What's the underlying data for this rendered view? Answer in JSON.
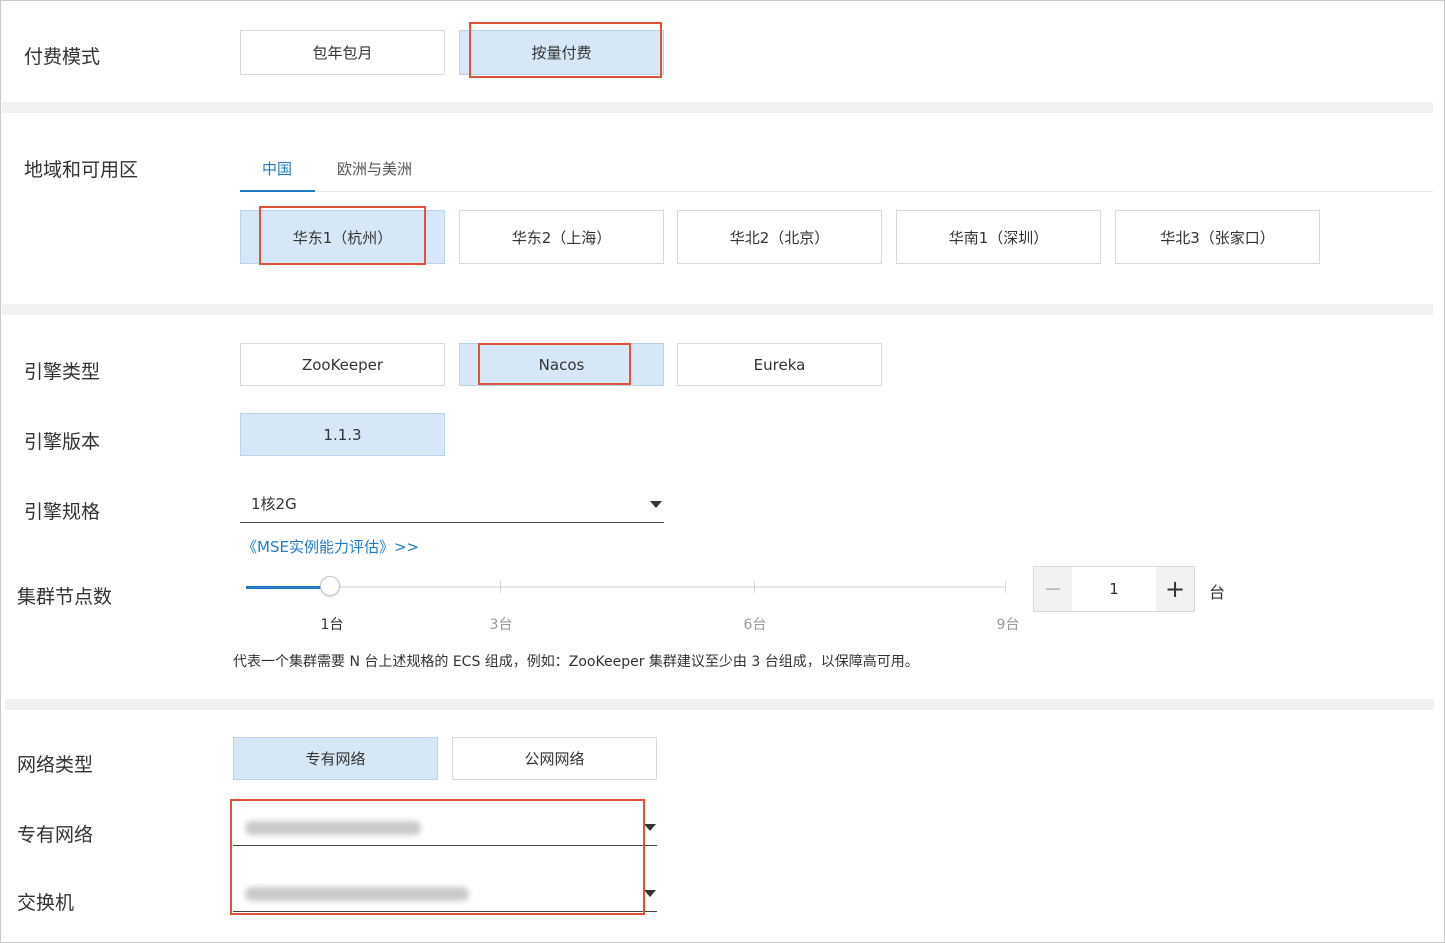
{
  "billing": {
    "label": "付费模式",
    "options": [
      "包年包月",
      "按量付费"
    ],
    "selected": "按量付费"
  },
  "region": {
    "label": "地域和可用区",
    "tabs": [
      "中国",
      "欧洲与美洲"
    ],
    "active_tab": "中国",
    "options": [
      "华东1（杭州）",
      "华东2（上海）",
      "华北2（北京）",
      "华南1（深圳）",
      "华北3（张家口）"
    ],
    "selected": "华东1（杭州）"
  },
  "engine": {
    "type_label": "引擎类型",
    "types": [
      "ZooKeeper",
      "Nacos",
      "Eureka"
    ],
    "selected_type": "Nacos",
    "version_label": "引擎版本",
    "version": "1.1.3",
    "spec_label": "引擎规格",
    "spec_value": "1核2G",
    "eval_link": "《MSE实例能力评估》>>"
  },
  "nodes": {
    "label": "集群节点数",
    "ticks": [
      "1台",
      "3台",
      "6台",
      "9台"
    ],
    "slider_min": 1,
    "slider_max": 9,
    "slider_value": 1,
    "stepper_value": "1",
    "minus": "−",
    "plus": "+",
    "unit": "台",
    "hint": "代表一个集群需要 N 台上述规格的 ECS 组成，例如：ZooKeeper 集群建议至少由 3 台组成，以保障高可用。"
  },
  "network": {
    "type_label": "网络类型",
    "types": [
      "专有网络",
      "公网网络"
    ],
    "selected_type": "专有网络",
    "vpc_label": "专有网络",
    "switch_label": "交换机"
  },
  "colors": {
    "accent": "#1f7bc7",
    "selected_bg": "#d6e8f7",
    "highlight": "#e0533a",
    "separator": "#f0f1f3"
  }
}
